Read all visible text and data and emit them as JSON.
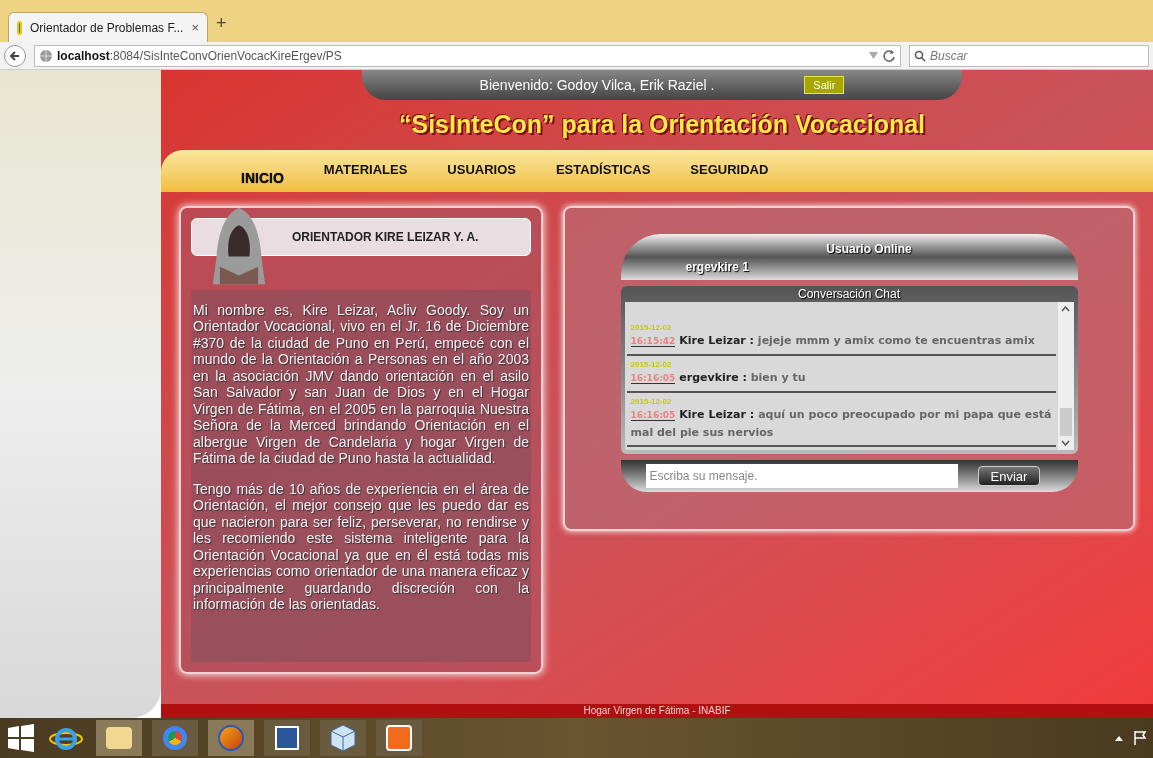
{
  "browser": {
    "tab_title": "Orientador de Problemas F...",
    "new_tab": "+",
    "close_tab": "×",
    "address_host": "localhost",
    "address_path": ":8084/SisInteConvOrienVocacKireErgev/PS",
    "search_placeholder": "Buscar"
  },
  "header": {
    "welcome": "Bienvenido: Godoy Vilca, Erik Raziel .",
    "logout_button": "Salir",
    "site_title": "“SisInteCon” para la Orientación Vocacional"
  },
  "nav": [
    {
      "label": "INICIO",
      "selected": true
    },
    {
      "label": "MATERIALES",
      "selected": false
    },
    {
      "label": "USUARIOS",
      "selected": false
    },
    {
      "label": "ESTADÍSTICAS",
      "selected": false
    },
    {
      "label": "SEGURIDAD",
      "selected": false
    }
  ],
  "profile": {
    "title": "ORIENTADOR KIRE LEIZAR Y. A.",
    "paragraphs": [
      "Mi nombre es, Kire Leizar, Acliv Goody. Soy un Orientador Vocacional, vivo en el Jr. 16 de Diciembre #370 de la ciudad de Puno en Perú, empecé con el mundo de la Orientación a Personas en el año 2003 en la asociación JMV dando orientación en el asilo San Salvador y san Juan de Dios y en el Hogar Virgen de Fátima, en el 2005 en la parroquia Nuestra Señora de la Merced brindando Orientación en el albergue Virgen de Candelaria y hogar Virgen de Fátima de la ciudad de Puno hasta la actualidad.",
      "Tengo más de 10 años de experiencia en el área de Orientación, el mejor consejo que les puedo dar es que nacieron para ser feliz, perseverar, no rendirse y les recomiendo este sistema inteligente para la Orientación Vocacional ya que en él está todas mis experiencias como orientador de una manera eficaz y principalmente guardando discreción con la información de las orientadas."
    ]
  },
  "chat": {
    "online_title": "Usuario Online",
    "online_users": [
      "ergevkire 1"
    ],
    "chat_title": "Conversación Chat",
    "messages": [
      {
        "date": "2015-12-02",
        "time": "16:15:42",
        "author": "Kire Leizar :",
        "text": "jejeje mmm y amix como te encuentras amix"
      },
      {
        "date": "2015-12-02",
        "time": "16:16:05",
        "author": "ergevkire :",
        "text": "bien y tu"
      },
      {
        "date": "2015-12-02",
        "time": "16:16:05",
        "author": "Kire Leizar :",
        "text": "aquí un poco preocupado por mi papa que está mal del pie sus nervios"
      }
    ],
    "input_placeholder": "Escriba su mensaje.",
    "send_button": "Enviar"
  },
  "footer": "Hogar Virgen de Fátima - INABIF"
}
